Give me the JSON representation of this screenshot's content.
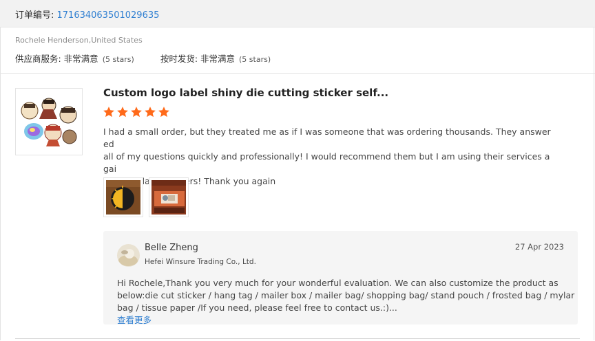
{
  "order": {
    "label": "订单编号: ",
    "number": "171634063501029635"
  },
  "buyer": {
    "name_country": "Rochele Henderson,United States",
    "supplier_service_label": "供应商服务: 非常满意",
    "supplier_service_stars": "(5 stars)",
    "on_time_label": "按时发货: 非常满意",
    "on_time_stars": "(5 stars)"
  },
  "review": {
    "product_title": "Custom logo label shiny die cutting sticker self...",
    "rating": 5,
    "star_color": "#ff6a1a",
    "text_lines": [
      "I had a small order, but they treated me as if I was someone that was ordering thousands.  They answered",
      "all of my questions quickly and professionally!   I would recommend them but I am using their services agai",
      "n for my larger orders!  Thank you again"
    ],
    "photos": [
      "sun-sticker-photo",
      "sticker-sheet-photo"
    ]
  },
  "reply": {
    "name": "Belle Zheng",
    "company": "Hefei Winsure Trading Co., Ltd.",
    "date": "27 Apr 2023",
    "text_lines": [
      "Hi Rochele,Thank you very much for your wonderful evaluation. We can also customize the product as",
      "below:die cut sticker / hang tag / mailer box / mailer bag/ shopping bag/ stand pouch / frosted bag / mylar",
      "bag / tissue paper /If you need, please feel free to contact us.:)..."
    ],
    "see_more": "查看更多"
  },
  "colors": {
    "link": "#2f7fd1",
    "header_bg": "#f2f2f2",
    "reply_bg": "#f5f5f5"
  }
}
